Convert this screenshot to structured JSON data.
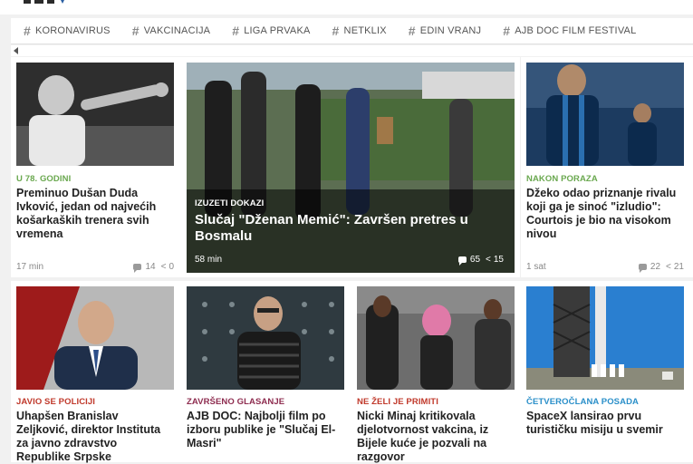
{
  "tags": [
    "KORONAVIRUS",
    "VAKCINACIJA",
    "LIGA PRVAKA",
    "NETKLIX",
    "EDIN VRANJ",
    "AJB DOC FILM FESTIVAL"
  ],
  "cards": [
    {
      "kicker": "U 78. GODINI",
      "title": "Preminuo Dušan Duda Ivković, jedan od najvećih košarkaških trenera svih vremena",
      "time": "17 min",
      "comments": "14",
      "shares": "0",
      "color": "#6aa84f"
    },
    {
      "kicker": "IZUZETI DOKAZI",
      "title": "Slučaj \"Dženan Memić\": Završen pretres u Bosmalu",
      "time": "58 min",
      "comments": "65",
      "shares": "15",
      "color": "#ffffff"
    },
    {
      "kicker": "NAKON PORAZA",
      "title": "Džeko odao priznanje rivalu koji ga je sinoć \"izludio\": Courtois je bio na visokom nivou",
      "time": "1 sat",
      "comments": "22",
      "shares": "21",
      "color": "#6aa84f"
    },
    {
      "kicker": "JAVIO SE POLICIJI",
      "title": "Uhapšen Branislav Zeljković, direktor Instituta za javno zdravstvo Republike Srpske",
      "color": "#c0392b"
    },
    {
      "kicker": "ZAVRŠENO GLASANJE",
      "title": "AJB DOC: Najbolji film po izboru publike je \"Slučaj El-Masri\"",
      "color": "#8e2c4f"
    },
    {
      "kicker": "NE ŽELI JE PRIMITI",
      "title": "Nicki Minaj kritikovala djelotvornost vakcina, iz Bijele kuće je pozvali na razgovor",
      "color": "#c0392b"
    },
    {
      "kicker": "ČETVEROČLANA POSADA",
      "title": "SpaceX lansirao prvu turističku misiju u svemir",
      "color": "#2a8fc9"
    }
  ]
}
